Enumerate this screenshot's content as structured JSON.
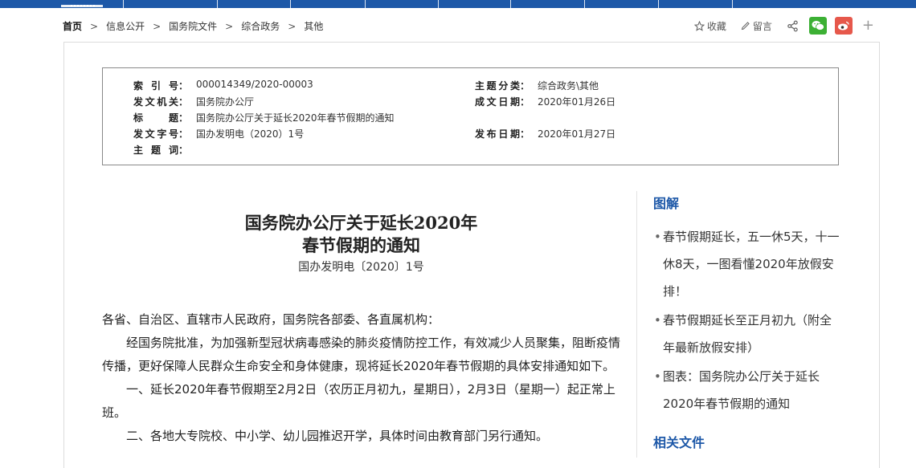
{
  "colors": {
    "nav": "#1d58a8",
    "accent": "#1d58a8",
    "wechat": "#3cb034",
    "weibo": "#e6584b"
  },
  "breadcrumb": [
    "首页",
    "信息公开",
    "国务院文件",
    "综合政务",
    "其他"
  ],
  "tools": {
    "collect": "收藏",
    "comment": "留言"
  },
  "meta": {
    "index_no_label": "索引号",
    "index_no": "000014349/2020-00003",
    "subject_label": "主题分类",
    "subject": "综合政务\\其他",
    "issuer_label": "发文机关",
    "issuer": "国务院办公厅",
    "date_label": "成文日期",
    "date": "2020年01月26日",
    "title_label": "标题",
    "title": "国务院办公厅关于延长2020年春节假期的通知",
    "doc_no_label": "发文字号",
    "doc_no": "国办发明电（2020）1号",
    "publish_label": "发布日期",
    "publish": "2020年01月27日",
    "keywords_label": "主题词",
    "keywords": ""
  },
  "article": {
    "title_line1": "国务院办公厅关于延长2020年",
    "title_line2": "春节假期的通知",
    "doc_no": "国办发明电〔2020〕1号",
    "p1": "各省、自治区、直辖市人民政府，国务院各部委、各直属机构：",
    "p2": "经国务院批准，为加强新型冠状病毒感染的肺炎疫情防控工作，有效减少人员聚集，阻断疫情传播，更好保障人民群众生命安全和身体健康，现将延长2020年春节假期的具体安排通知如下。",
    "p3": "一、延长2020年春节假期至2月2日（农历正月初九，星期日），2月3日（星期一）起正常上班。",
    "p4": "二、各地大专院校、中小学、幼儿园推迟开学，具体时间由教育部门另行通知。"
  },
  "sidebar": {
    "heading": "图解",
    "items": [
      "春节假期延长，五一休5天，十一休8天，一图看懂2020年放假安排！",
      "春节假期延长至正月初九（附全年最新放假安排）",
      "图表：国务院办公厅关于延长2020年春节假期的通知"
    ],
    "related_heading": "相关文件"
  }
}
